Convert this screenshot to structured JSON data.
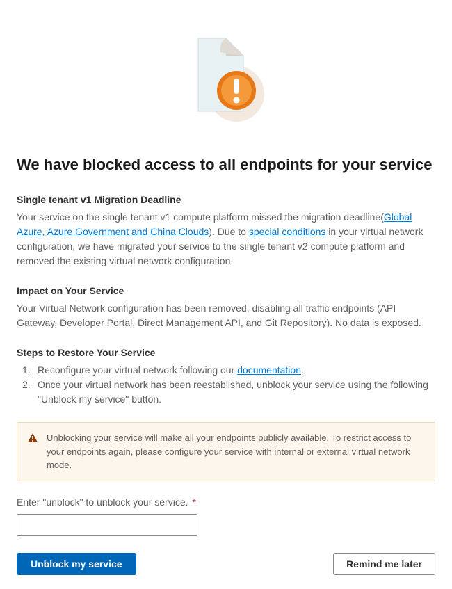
{
  "title": "We have blocked access to all endpoints for your service",
  "section1": {
    "heading": "Single tenant v1 Migration Deadline",
    "body_part1": "Your service on the single tenant v1 compute platform missed the migration deadline(",
    "link1": "Global Azure",
    "body_part2": ", ",
    "link2": "Azure Government and China Clouds",
    "body_part3": "). Due to ",
    "link3": "special conditions",
    "body_part4": " in your virtual network configuration, we have migrated your service to the single tenant v2 compute platform and removed the existing virtual network configuration."
  },
  "section2": {
    "heading": "Impact on Your Service",
    "body": "Your Virtual Network configuration has been removed, disabling all traffic endpoints (API Gateway, Developer Portal, Direct Management API, and Git Repository). No data is exposed."
  },
  "section3": {
    "heading": "Steps to Restore Your Service",
    "step1_num": "1.",
    "step1_text_a": "Reconfigure your virtual network following our ",
    "step1_link": "documentation",
    "step1_text_b": ".",
    "step2_num": "2.",
    "step2_text": "Once your virtual network has been reestablished, unblock your service using the following \"Unblock my service\" button."
  },
  "warning": {
    "text": "Unblocking your service will make all your endpoints publicly available. To restrict access to your endpoints again, please configure your service with internal or external virtual network mode."
  },
  "input": {
    "label": "Enter \"unblock\" to unblock your service.",
    "required_mark": "*",
    "value": ""
  },
  "buttons": {
    "primary": "Unblock my service",
    "secondary": "Remind me later"
  }
}
